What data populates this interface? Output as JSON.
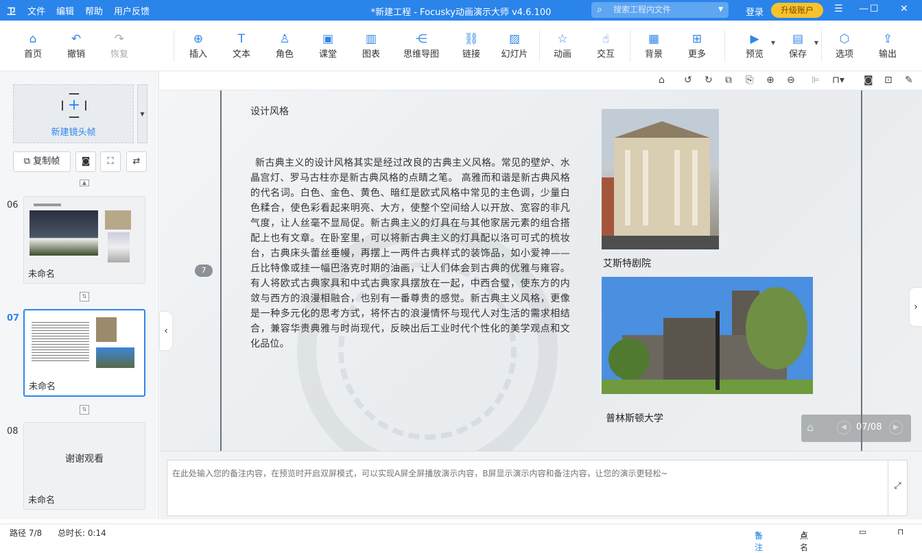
{
  "titlebar": {
    "logo": "卫",
    "menu": [
      "文件",
      "编辑",
      "帮助",
      "用户反馈"
    ],
    "window_title": "*新建工程 - Focusky动画演示大师  v4.6.100",
    "search_placeholder": "搜索工程内文件",
    "login": "登录",
    "upgrade": "升级账户"
  },
  "toolbar": {
    "home": "首页",
    "undo": "撤销",
    "redo": "恢复",
    "insert": "插入",
    "text": "文本",
    "role": "角色",
    "classroom": "课堂",
    "chart": "图表",
    "mindmap": "思维导图",
    "link": "链接",
    "slide": "幻灯片",
    "animation": "动画",
    "interact": "交互",
    "background": "背景",
    "more": "更多",
    "preview": "预览",
    "save": "保存",
    "options": "选项",
    "export": "输出"
  },
  "left_panel": {
    "new_frame": "新建镜头帧",
    "copy_frame": "复制帧",
    "frames": [
      {
        "num": "06",
        "name": "未命名",
        "active": false
      },
      {
        "num": "07",
        "name": "未命名",
        "active": true
      },
      {
        "num": "08",
        "name": "未命名",
        "active": false,
        "text": "谢谢观看"
      }
    ]
  },
  "slide": {
    "badge": "7",
    "heading": "设计风格",
    "body": "新古典主义的设计风格其实是经过改良的古典主义风格。常见的壁炉、水晶宫灯、罗马古柱亦是新古典风格的点睛之笔。 高雅而和谐是新古典风格的代名词。白色、金色、黄色、暗红是欧式风格中常见的主色调，少量白色糅合，使色彩看起来明亮、大方，使整个空间给人以开放、宽容的非凡气度，让人丝毫不显局促。新古典主义的灯具在与其他家居元素的组合搭配上也有文章。在卧室里，可以将新古典主义的灯具配以洛可可式的梳妆台，古典床头蕾丝垂幔，再摆上一两件古典样式的装饰品，如小爱神——丘比特像或挂一幅巴洛克时期的油画，让人们体会到古典的优雅与雍容。有人将欧式古典家具和中式古典家具摆放在一起，中西合璧，使东方的内敛与西方的浪漫相融合，也别有一番尊贵的感觉。新古典主义风格，更像是一种多元化的思考方式，将怀古的浪漫情怀与现代人对生活的需求相结合，兼容华贵典雅与时尚现代，反映出后工业时代个性化的美学观点和文化品位。",
    "caption1": "艾斯特剧院",
    "caption2": "普林斯顿大学",
    "pager": "07/08"
  },
  "notes": {
    "placeholder": "在此处输入您的备注内容，在预览时开启双屏模式，可以实现A屏全屏播放演示内容，B屏显示演示内容和备注内容，让您的演示更轻松~"
  },
  "status": {
    "path": "路径 7/8",
    "duration": "总时长: 0:14",
    "notes": "备注",
    "rollcall": "点名"
  }
}
